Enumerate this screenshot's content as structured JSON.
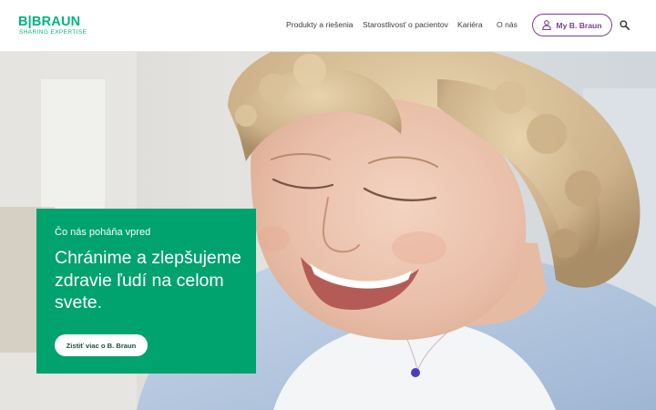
{
  "brand": {
    "name": "B|BRAUN",
    "tagline": "SHARING EXPERTISE"
  },
  "nav": {
    "items": [
      {
        "label": "Produkty a riešenia"
      },
      {
        "label": "Starostlivosť o pacientov"
      },
      {
        "label": "Kariéra"
      },
      {
        "label": "O nás"
      }
    ],
    "account_label": "My B. Braun"
  },
  "hero": {
    "eyebrow": "Čo nás poháňa vpred",
    "title": "Chránime a zlepšujeme zdravie ľudí na celom svete.",
    "cta_label": "Zistiť viac o B. Braun"
  },
  "colors": {
    "brand_green": "#00b482",
    "card_green": "#00a26d",
    "account_purple": "#7c3e97"
  },
  "icons": {
    "account": "user-icon",
    "search": "search-icon"
  }
}
